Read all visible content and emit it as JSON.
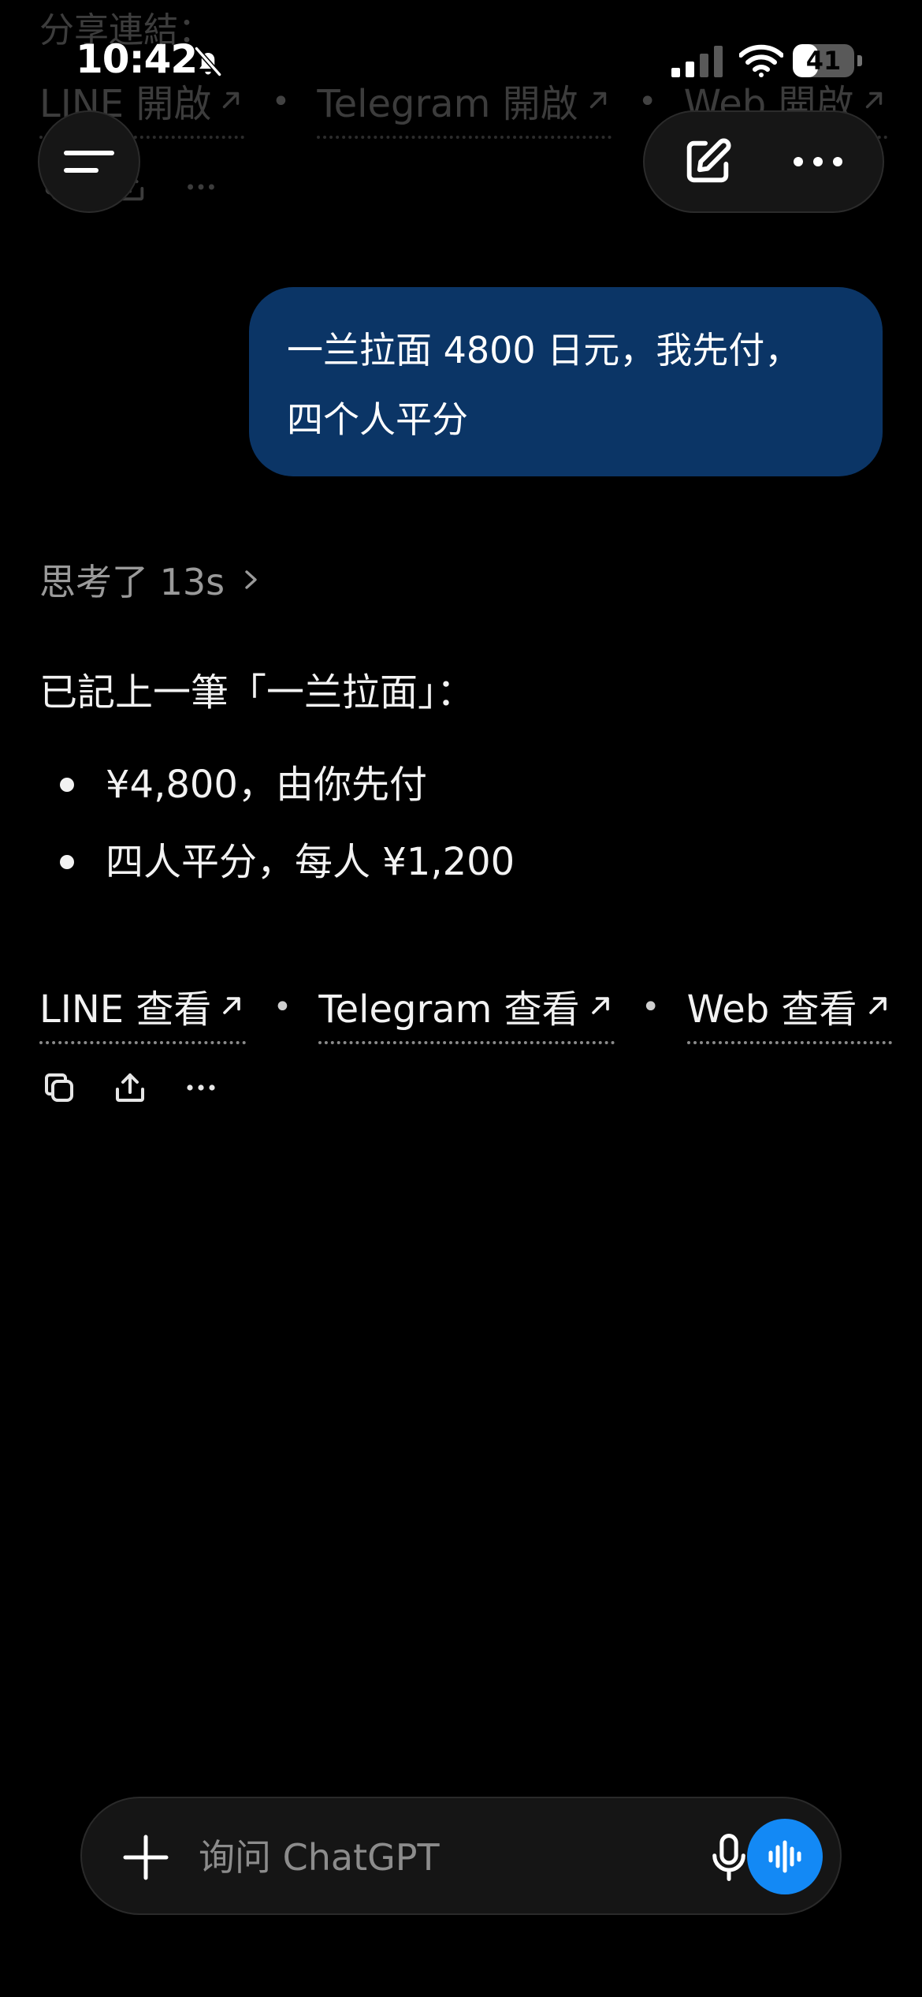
{
  "status_bar": {
    "time": "10:42",
    "battery_level": "41",
    "battery_fraction": 0.41
  },
  "previous_message": {
    "share_label": "分享連結：",
    "links": [
      {
        "label": "LINE 開啟"
      },
      {
        "label": "Telegram 開啟"
      },
      {
        "label": "Web 開啟"
      }
    ],
    "separator": "•"
  },
  "user_message": {
    "line1": "一兰拉面 4800 日元，我先付，",
    "line2": "四个人平分"
  },
  "assistant": {
    "thinking_label": "思考了 13s",
    "intro": "已記上一筆「一兰拉面」：",
    "bullets": [
      "¥4,800，由你先付",
      "四人平分，每人 ¥1,200"
    ],
    "links": [
      {
        "label": "LINE 查看"
      },
      {
        "label": "Telegram 查看"
      },
      {
        "label": "Web 查看"
      }
    ],
    "separator": "•"
  },
  "composer": {
    "placeholder": "询问 ChatGPT"
  },
  "colors": {
    "background": "#000000",
    "user_bubble": "#0b3566",
    "voice_button": "#1389f5",
    "muted_text": "#9a9a9a"
  },
  "icons": {
    "status": [
      "bell-slash-icon",
      "signal-icon",
      "wifi-icon",
      "battery-icon"
    ],
    "header": [
      "menu-icon",
      "compose-icon",
      "more-icon"
    ],
    "actions": [
      "copy-icon",
      "share-icon",
      "more-icon"
    ],
    "composer": [
      "plus-icon",
      "microphone-icon",
      "voice-wave-icon"
    ]
  }
}
